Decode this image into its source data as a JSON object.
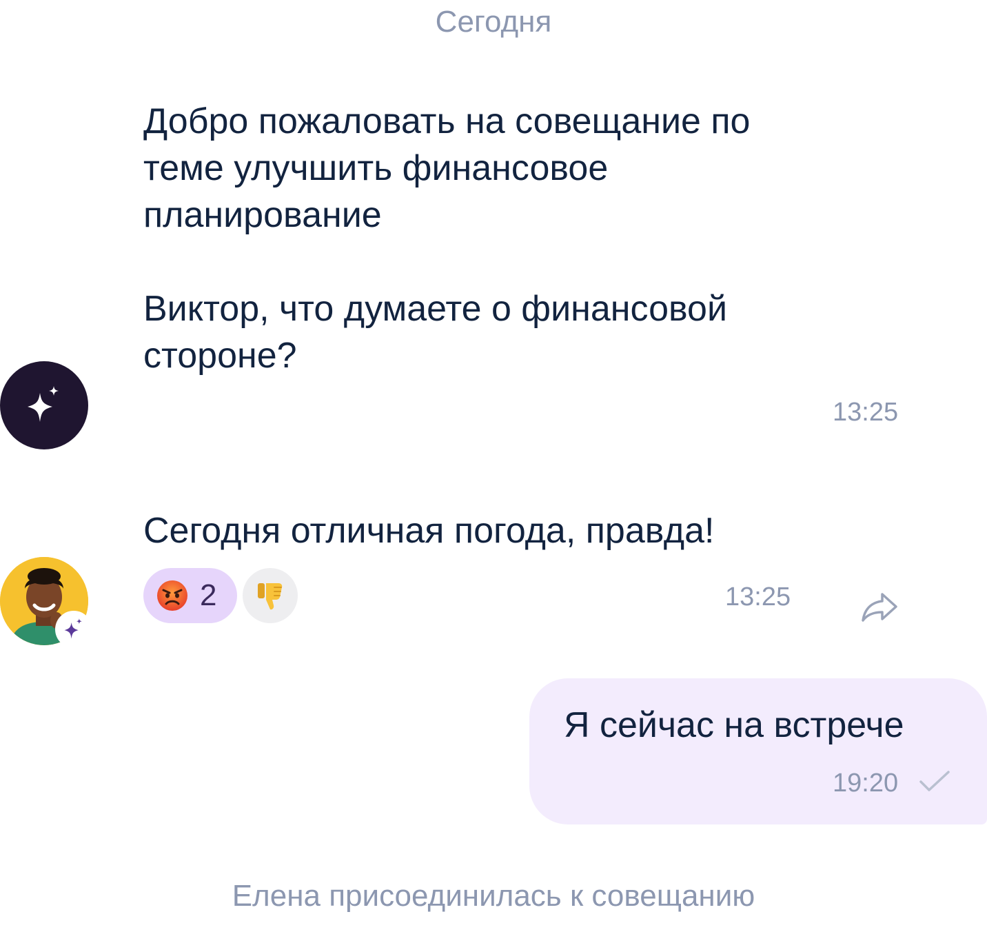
{
  "chat": {
    "date_divider": "Сегодня",
    "messages": [
      {
        "author": "assistant",
        "text": "Добро пожаловать на совещание по\nтеме улучшить финансовое\nпланирование\n\nВиктор, что думаете о финансовой\nстороне?",
        "time": "13:25"
      },
      {
        "author": "participant",
        "text": "Сегодня отличная погода, правда!",
        "time": "13:25",
        "reactions": [
          {
            "emoji": "😡",
            "icon": "angry-face-icon",
            "count": "2",
            "selected": true
          },
          {
            "emoji": "👎",
            "icon": "thumbs-down-icon",
            "count": "",
            "selected": false
          }
        ]
      },
      {
        "author": "me",
        "text": "Я сейчас на встрече",
        "time": "19:20",
        "status": "sent"
      }
    ],
    "system_message": "Елена присоединилась к совещанию"
  },
  "colors": {
    "text_primary": "#12233f",
    "text_muted": "#8c97b0",
    "ai_avatar_bg": "#1f1530",
    "accent_purple": "#5b3a9a",
    "reaction_selected_bg": "#e6d5fb",
    "reaction_bg": "#eeeef0",
    "outgoing_bubble_bg": "#f3ecfd",
    "user_avatar_bg": "#f6c12e"
  }
}
